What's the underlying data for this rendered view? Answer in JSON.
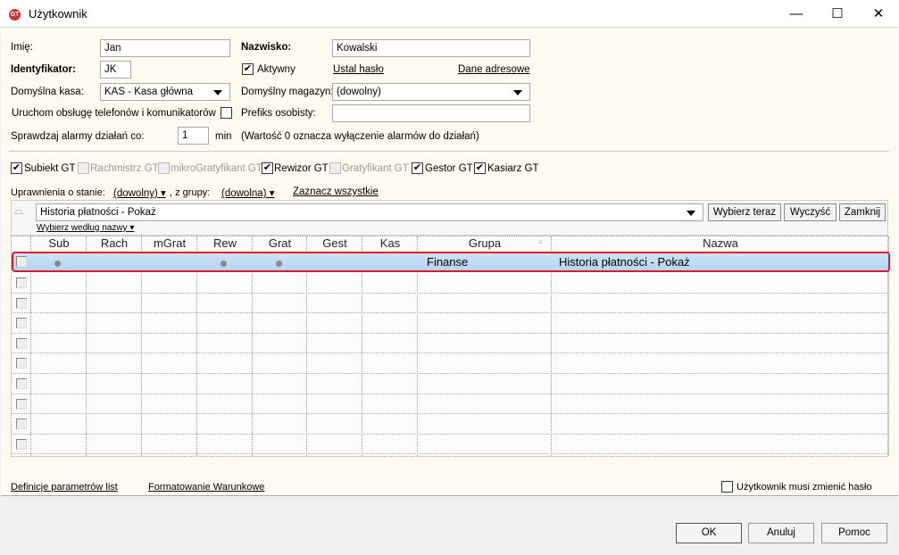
{
  "window": {
    "title": "Użytkownik",
    "logo": "GT",
    "minimize": "—",
    "maximize": "☐",
    "close": "✕"
  },
  "form": {
    "imie_label": "Imię:",
    "imie_value": "Jan",
    "nazwisko_label": "Nazwisko:",
    "nazwisko_value": "Kowalski",
    "identyfikator_label": "Identyfikator:",
    "identyfikator_value": "JK",
    "aktywny_label": "Aktywny",
    "aktywny_checked": true,
    "ustal_haslo": "Ustal hasło",
    "dane_adresowe": "Dane adresowe",
    "kasa_label": "Domyślna kasa:",
    "kasa_value": "KAS - Kasa główna",
    "magazyn_label": "Domyślny magazyn:",
    "magazyn_value": "(dowolny)",
    "telefony_label": "Uruchom obsługę telefonów i komunikatorów",
    "telefony_checked": false,
    "prefiks_label": "Prefiks osobisty:",
    "prefiks_value": "",
    "alarmy_label": "Sprawdzaj alarmy działań co:",
    "alarmy_value": "1",
    "alarmy_unit": "min",
    "alarmy_note": "(Wartość 0 oznacza wyłączenie alarmów do działań)"
  },
  "modules": [
    {
      "label": "Subiekt GT",
      "checked": true,
      "enabled": true
    },
    {
      "label": "Rachmistrz GT",
      "checked": false,
      "enabled": false
    },
    {
      "label": "mikroGratyfikant GT",
      "checked": false,
      "enabled": false
    },
    {
      "label": "Rewizor GT",
      "checked": true,
      "enabled": true
    },
    {
      "label": "Gratyfikant GT",
      "checked": false,
      "enabled": false
    },
    {
      "label": "Gestor GT",
      "checked": true,
      "enabled": true
    },
    {
      "label": "Kasiarz GT",
      "checked": true,
      "enabled": true
    }
  ],
  "filter": {
    "stan_label": "Uprawnienia o stanie:",
    "stan_value": "(dowolny)",
    "grupa_label": ", z grupy:",
    "grupa_value": "(dowolna)",
    "zaznacz": "Zaznacz wszystkie",
    "search_value": "Historia płatności - Pokaż",
    "wybierz_wg": "Wybierz według nazwy",
    "wybierz_teraz": "Wybierz teraz",
    "wyczysc": "Wyczyść",
    "zamknij": "Zamknij"
  },
  "table": {
    "columns": [
      "Sub",
      "Rach",
      "mGrat",
      "Rew",
      "Grat",
      "Gest",
      "Kas",
      "Grupa",
      "Nazwa"
    ],
    "sort_indicator": "▵",
    "rows": [
      {
        "checked": false,
        "marks": {
          "Sub": true,
          "Rew": true,
          "Grat": true
        },
        "grupa": "Finanse",
        "nazwa": "Historia płatności - Pokaż",
        "selected": true
      }
    ],
    "empty_rows": 9
  },
  "footer": {
    "definicje": "Definicje parametrów list",
    "formatowanie": "Formatowanie Warunkowe",
    "musi_zmienic": "Użytkownik musi zmienić hasło",
    "musi_zmienic_checked": false,
    "ok": "OK",
    "anuluj": "Anuluj",
    "pomoc": "Pomoc"
  }
}
